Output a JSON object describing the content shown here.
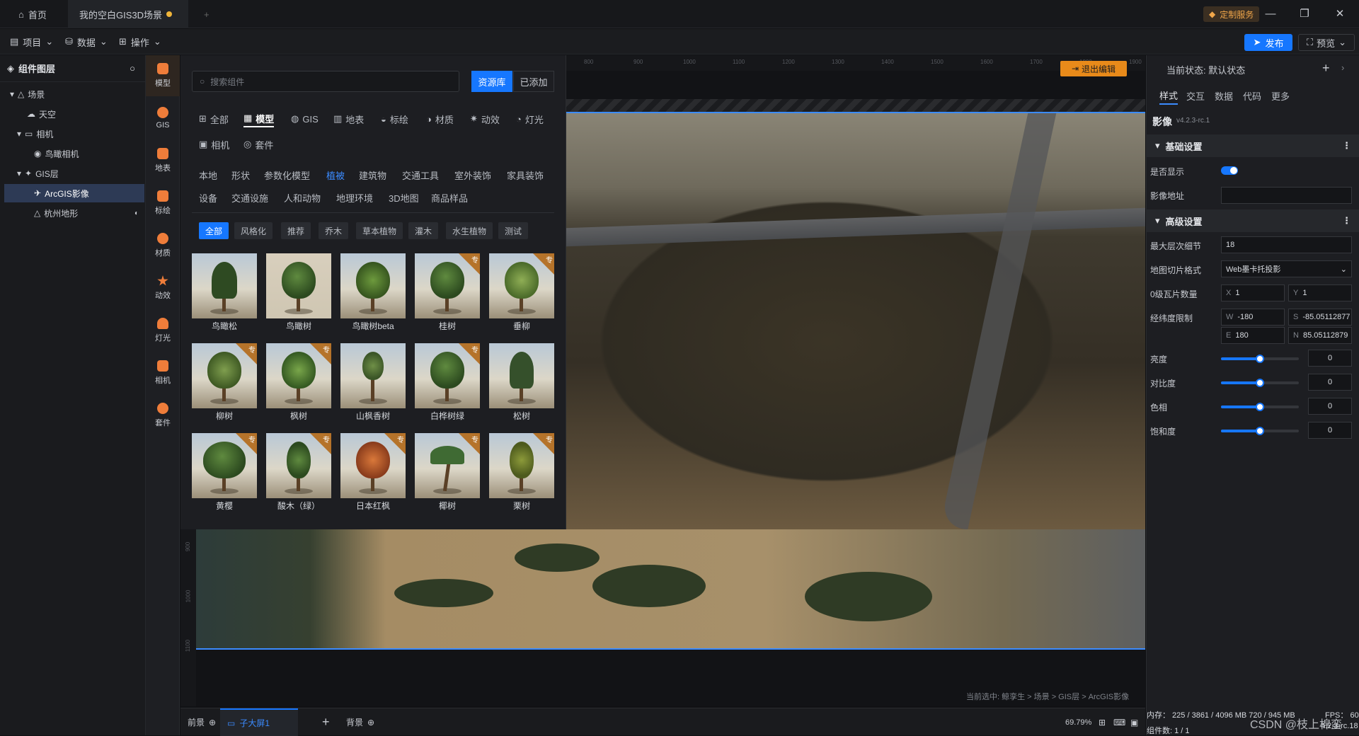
{
  "titlebar": {
    "home_tab": "首页",
    "scene_tab": "我的空白GIS3D场景",
    "custom_service": "定制服务",
    "min": "—",
    "restore": "❐",
    "close": "✕",
    "new_tab": "+"
  },
  "menubar": {
    "project": "项目",
    "data": "数据",
    "operate": "操作",
    "publish": "发布",
    "preview": "预览"
  },
  "layers": {
    "title": "组件图层",
    "items": [
      {
        "label": "场景"
      },
      {
        "label": "天空"
      },
      {
        "label": "相机"
      },
      {
        "label": "鸟瞰相机"
      },
      {
        "label": "GIS层"
      },
      {
        "label": "ArcGIS影像"
      },
      {
        "label": "杭州地形"
      }
    ]
  },
  "rail": {
    "items": [
      {
        "label": "模型"
      },
      {
        "label": "GIS"
      },
      {
        "label": "地表"
      },
      {
        "label": "标绘"
      },
      {
        "label": "材质"
      },
      {
        "label": "动效"
      },
      {
        "label": "灯光"
      },
      {
        "label": "相机"
      },
      {
        "label": "套件"
      }
    ]
  },
  "resource": {
    "search_placeholder": "搜索组件",
    "library": "资源库",
    "added": "已添加",
    "categories": [
      "全部",
      "模型",
      "GIS",
      "地表",
      "标绘",
      "材质",
      "动效",
      "灯光",
      "相机",
      "套件"
    ],
    "subtabs_row1": [
      "本地",
      "形状",
      "参数化模型",
      "植被",
      "建筑物",
      "交通工具",
      "室外装饰",
      "家具装饰"
    ],
    "subtabs_row2": [
      "设备",
      "交通设施",
      "人和动物",
      "地理环境",
      "3D地图",
      "商品样品"
    ],
    "filters": [
      "全部",
      "风格化",
      "推荐",
      "乔木",
      "草本植物",
      "灌木",
      "水生植物",
      "测试"
    ],
    "pro_badge": "专",
    "cards": [
      {
        "name": "鸟瞰松"
      },
      {
        "name": "鸟瞰树"
      },
      {
        "name": "鸟瞰树beta"
      },
      {
        "name": "桂树"
      },
      {
        "name": "垂柳"
      },
      {
        "name": "柳树"
      },
      {
        "name": "枫树"
      },
      {
        "name": "山枫香树"
      },
      {
        "name": "白桦树绿"
      },
      {
        "name": "松树"
      },
      {
        "name": "黄樱"
      },
      {
        "name": "酸木（绿）"
      },
      {
        "name": "日本红枫"
      },
      {
        "name": "椰树"
      },
      {
        "name": "栗树"
      }
    ]
  },
  "canvas": {
    "exit_edit": "退出编辑",
    "breadcrumb": "当前选中: 鲸孪生 > 场景 > GIS层 > ArcGIS影像",
    "ruler_top": [
      "800",
      "900",
      "1000",
      "1100",
      "1200",
      "1300",
      "1400",
      "1500",
      "1600",
      "1700",
      "1800",
      "1900"
    ],
    "ruler_left": [
      "900",
      "1000",
      "1100"
    ]
  },
  "bottombar": {
    "front": "前景",
    "sub_screen": "子大屏1",
    "add": "+",
    "back": "背景",
    "zoom": "69.79%"
  },
  "right": {
    "state": "当前状态:  默认状态",
    "tabs": [
      "样式",
      "交互",
      "数据",
      "代码",
      "更多"
    ],
    "title": "影像",
    "version": "v4.2.3-rc.1",
    "basic": "基础设置",
    "visible_label": "是否显示",
    "visible": true,
    "url_label": "影像地址",
    "url_value": "",
    "advanced": "高级设置",
    "max_level_label": "最大层次细节",
    "max_level": "18",
    "tiling_label": "地图切片格式",
    "tiling": "Web墨卡托投影",
    "tile_count_label": "0级瓦片数量",
    "tile_x": "1",
    "tile_y": "1",
    "bounds_label": "经纬度限制",
    "w": "-180",
    "s": "-85.05112877",
    "e": "180",
    "n": "85.05112879",
    "brightness_label": "亮度",
    "brightness": "0",
    "contrast_label": "对比度",
    "contrast": "0",
    "hue_label": "色相",
    "hue": "0",
    "saturation_label": "饱和度",
    "saturation": "0",
    "slider_level": 0.5
  },
  "status": {
    "memory": "内存：  225 / 3861 / 4096 MB  720 / 945 MB",
    "fps": "FPS：  60",
    "count": "组件数: 1 / 1",
    "version": "4.2.3-rc.18"
  },
  "watermark": "CSDN @枝上棉蛮"
}
